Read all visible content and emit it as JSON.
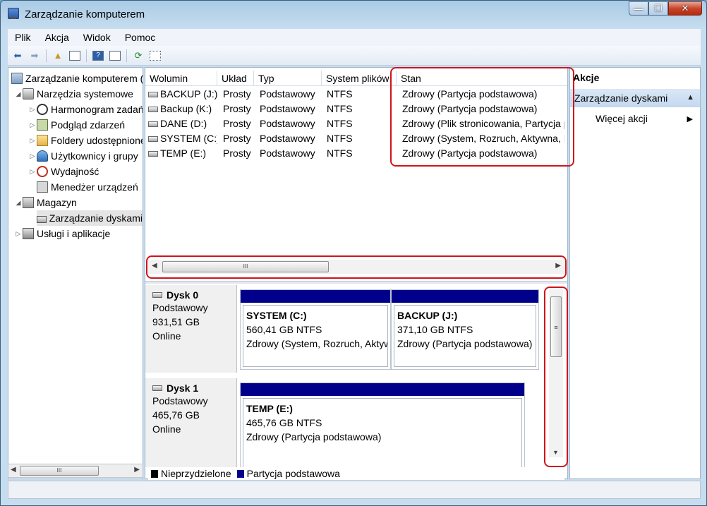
{
  "window": {
    "title": "Zarządzanie komputerem"
  },
  "caption": {
    "minimize": "—",
    "maximize": "☐",
    "close": "✕"
  },
  "menu": [
    "Plik",
    "Akcja",
    "Widok",
    "Pomoc"
  ],
  "tree": [
    {
      "label": "Zarządzanie komputerem (lokalny)",
      "icon": "computer-icon"
    },
    {
      "label": "Narzędzia systemowe",
      "icon": "tools-icon"
    },
    {
      "label": "Harmonogram zadań",
      "icon": "clock-icon"
    },
    {
      "label": "Podgląd zdarzeń",
      "icon": "event-log-icon"
    },
    {
      "label": "Foldery udostępnione",
      "icon": "shared-folder-icon"
    },
    {
      "label": "Użytkownicy i grupy",
      "icon": "users-icon"
    },
    {
      "label": "Wydajność",
      "icon": "performance-icon"
    },
    {
      "label": "Menedżer urządzeń",
      "icon": "device-manager-icon"
    },
    {
      "label": "Magazyn",
      "icon": "storage-icon"
    },
    {
      "label": "Zarządzanie dyskami",
      "icon": "disk-management-icon"
    },
    {
      "label": "Usługi i aplikacje",
      "icon": "services-icon"
    }
  ],
  "volumes": {
    "columns": [
      "Wolumin",
      "Układ",
      "Typ",
      "System plików",
      "Stan"
    ],
    "rows": [
      [
        "BACKUP (J:)",
        "Prosty",
        "Podstawowy",
        "NTFS",
        "Zdrowy (Partycja podstawowa)"
      ],
      [
        "Backup (K:)",
        "Prosty",
        "Podstawowy",
        "NTFS",
        "Zdrowy (Partycja podstawowa)"
      ],
      [
        "DANE (D:)",
        "Prosty",
        "Podstawowy",
        "NTFS",
        "Zdrowy (Plik stronicowania, Partycja podstawowa)"
      ],
      [
        "SYSTEM (C:)",
        "Prosty",
        "Podstawowy",
        "NTFS",
        "Zdrowy (System, Rozruch, Aktywna, Partycja podstawowa)"
      ],
      [
        "TEMP (E:)",
        "Prosty",
        "Podstawowy",
        "NTFS",
        "Zdrowy (Partycja podstawowa)"
      ]
    ]
  },
  "scroll_grip": "III",
  "disks": [
    {
      "name": "Dysk 0",
      "type": "Podstawowy",
      "size": "931,51 GB",
      "status": "Online",
      "partitions": [
        {
          "name": "SYSTEM  (C:)",
          "size": "560,41 GB NTFS",
          "status": "Zdrowy (System, Rozruch, Aktywna, Partycja podstawowa)"
        },
        {
          "name": "BACKUP  (J:)",
          "size": "371,10 GB NTFS",
          "status": "Zdrowy (Partycja podstawowa)"
        }
      ]
    },
    {
      "name": "Dysk 1",
      "type": "Podstawowy",
      "size": "465,76 GB",
      "status": "Online",
      "partitions": [
        {
          "name": "TEMP  (E:)",
          "size": "465,76 GB NTFS",
          "status": "Zdrowy (Partycja podstawowa)"
        }
      ]
    }
  ],
  "legend": [
    {
      "label": "Nieprzydzielone",
      "color": "#000000"
    },
    {
      "label": "Partycja podstawowa",
      "color": "#00008b"
    }
  ],
  "actions": {
    "title": "Akcje",
    "section": "Zarządzanie dyskami",
    "more": "Więcej akcji"
  },
  "colors": {
    "highlight": "#d0131a",
    "partition_bar": "#00008b",
    "action_section": "#c3d8ef"
  }
}
